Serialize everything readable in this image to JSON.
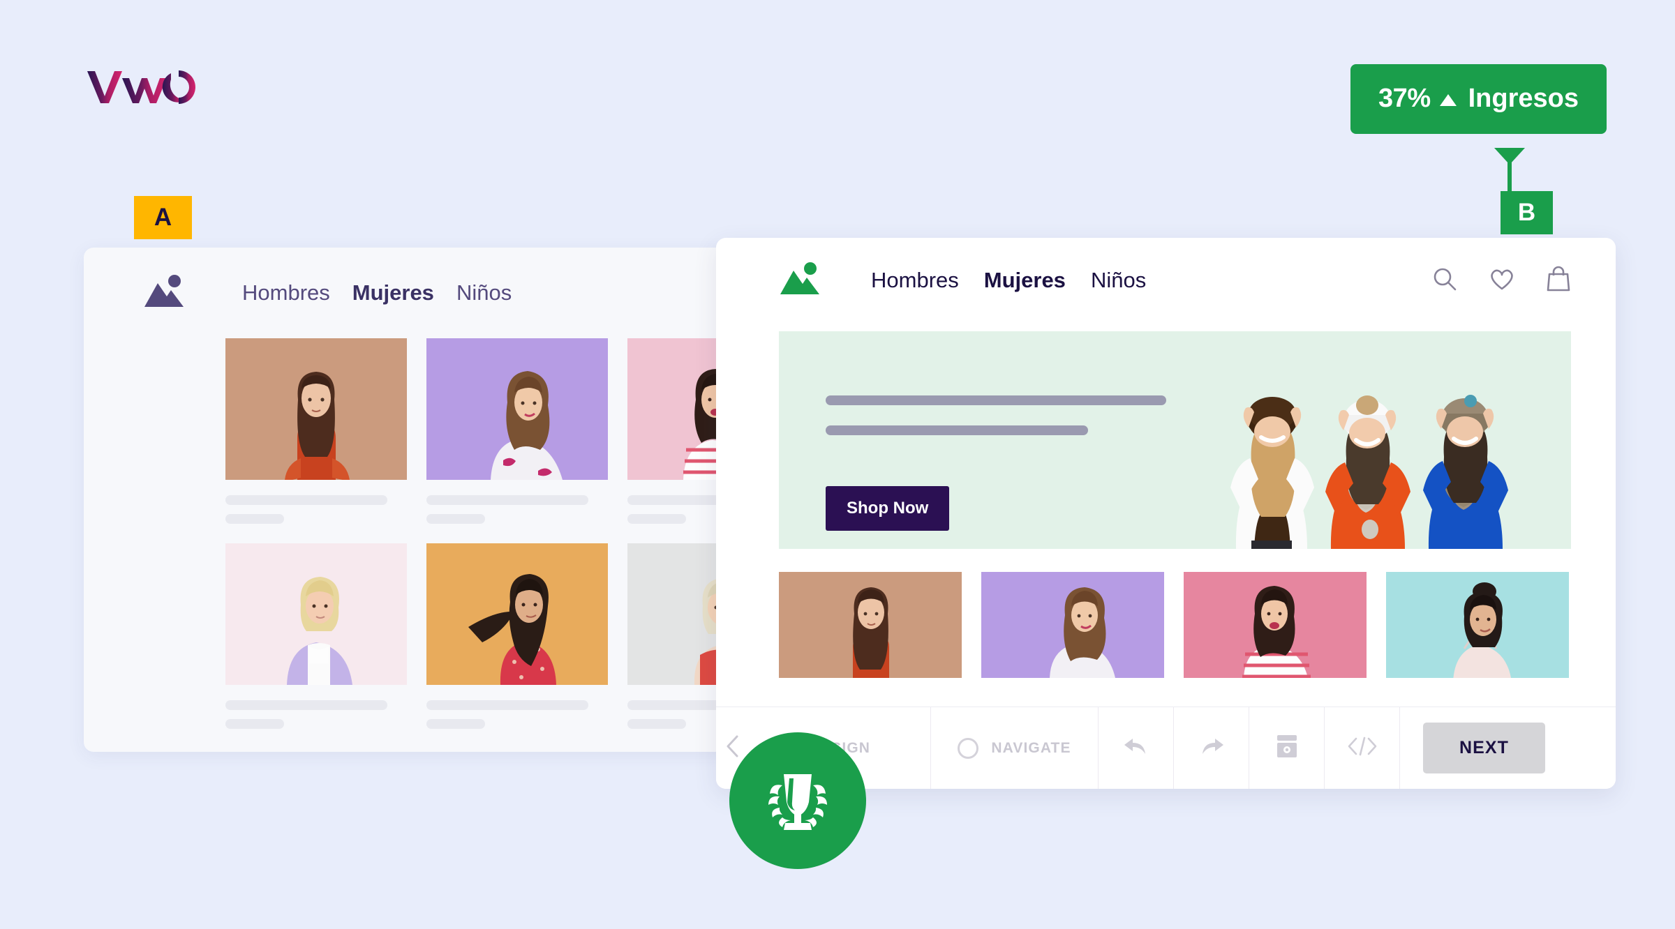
{
  "brand": {
    "logo_name": "vwo-logo",
    "gradient_start": "#2a1553",
    "gradient_end": "#d6246e"
  },
  "background_color": "#e8edfb",
  "variant_a": {
    "badge_label": "A",
    "badge_color": "#ffb600",
    "badge_text_color": "#1b1142",
    "window_background": "#f7f8fb",
    "logo_icon": "mountain-icon",
    "logo_color": "#544a7d",
    "nav_items": [
      {
        "label": "Hombres",
        "active": false
      },
      {
        "label": "Mujeres",
        "active": true
      },
      {
        "label": "Niños",
        "active": false
      }
    ],
    "products": [
      {
        "name": "product-card-1",
        "bg": "#cb9b7e"
      },
      {
        "name": "product-card-2",
        "bg": "#b69ce4"
      },
      {
        "name": "product-card-3",
        "bg": "#f0c4d2"
      },
      {
        "name": "product-card-4",
        "bg": "#f7e9ee"
      },
      {
        "name": "product-card-5",
        "bg": "#e8ab5c"
      },
      {
        "name": "product-card-6",
        "bg": "#e3e4e4"
      }
    ]
  },
  "callout": {
    "percent": "37%",
    "arrow_icon": "triangle-up-icon",
    "metric_label": "Ingresos",
    "color": "#1a9e4b",
    "text_color": "#ffffff"
  },
  "variant_b": {
    "badge_label": "B",
    "badge_color": "#1a9e4b",
    "badge_text_color": "#ffffff",
    "window_background": "#ffffff",
    "logo_icon": "mountain-icon",
    "logo_color": "#1a9e4b",
    "nav_items": [
      {
        "label": "Hombres",
        "active": false
      },
      {
        "label": "Mujeres",
        "active": true
      },
      {
        "label": "Niños",
        "active": false
      }
    ],
    "nav_icons": [
      {
        "name": "search-icon"
      },
      {
        "name": "heart-icon"
      },
      {
        "name": "shopping-bag-icon"
      }
    ],
    "hero": {
      "background": "#e2f2e8",
      "headline_placeholder_1": "",
      "headline_placeholder_2": "",
      "cta_label": "Shop Now",
      "cta_bg": "#2b1053",
      "cta_text_color": "#ffffff",
      "image_name": "three-women-winter-hats"
    },
    "products": [
      {
        "name": "product-card-1",
        "bg": "#cb9b7e"
      },
      {
        "name": "product-card-2",
        "bg": "#b69ce4"
      },
      {
        "name": "product-card-3",
        "bg": "#e6869f"
      },
      {
        "name": "product-card-4",
        "bg": "#a7e0e2"
      }
    ],
    "toolbar": {
      "back_icon": "chevron-left-icon",
      "design_label": "DESIGN",
      "navigate_icon": "circle-icon",
      "navigate_label": "NAVIGATE",
      "undo_icon": "undo-arrow-icon",
      "redo_icon": "redo-arrow-icon",
      "screenshot_icon": "screenshot-icon",
      "code_icon": "code-icon",
      "next_label": "NEXT",
      "next_bg": "#d5d5d8",
      "next_text_color": "#1b1142"
    }
  },
  "winner_badge": {
    "icon_name": "trophy-laurel-icon",
    "color": "#1a9e4b"
  }
}
